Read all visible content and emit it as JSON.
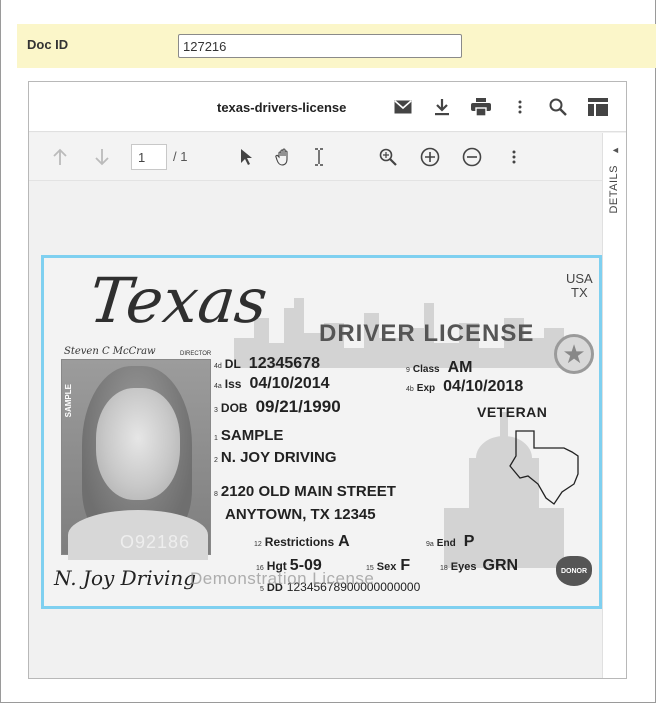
{
  "docid": {
    "label": "Doc ID",
    "value": "127216"
  },
  "viewer": {
    "file_title": "texas-drivers-license",
    "page_current": "1",
    "page_total": "/ 1",
    "details_label": "DETAILS",
    "details_arrow": "◄"
  },
  "card": {
    "state": "Texas",
    "usa": "USA",
    "usa_state": "TX",
    "title": "DRIVER LICENSE",
    "director_sig": "Steven C McCraw",
    "director_label": "DIRECTOR",
    "photo_sample": "SAMPLE",
    "photo_num": "O92186",
    "dl": {
      "num": "4d",
      "label": "DL",
      "value": "12345678"
    },
    "iss": {
      "num": "4a",
      "label": "Iss",
      "value": "04/10/2014"
    },
    "dob": {
      "num": "3",
      "label": "DOB",
      "value": "09/21/1990"
    },
    "class": {
      "num": "9",
      "label": "Class",
      "value": "AM"
    },
    "exp": {
      "num": "4b",
      "label": "Exp",
      "value": "04/10/2018"
    },
    "veteran": "VETERAN",
    "name1": {
      "num": "1",
      "value": "SAMPLE"
    },
    "name2": {
      "num": "2",
      "value": "N. JOY DRIVING"
    },
    "addr1": {
      "num": "8",
      "value": "2120 OLD MAIN STREET"
    },
    "addr2": "ANYTOWN, TX 12345",
    "restrictions": {
      "num": "12",
      "label": "Restrictions",
      "value": "A"
    },
    "end": {
      "num": "9a",
      "label": "End",
      "value": "P"
    },
    "hgt": {
      "num": "16",
      "label": "Hgt",
      "value": "5-09"
    },
    "sex": {
      "num": "15",
      "label": "Sex",
      "value": "F"
    },
    "eyes": {
      "num": "18",
      "label": "Eyes",
      "value": "GRN"
    },
    "dd": {
      "num": "5",
      "label": "DD",
      "value": "12345678900000000000"
    },
    "signature": "N. Joy Driving",
    "watermark": "Demonstration License",
    "donor": "DONOR"
  }
}
